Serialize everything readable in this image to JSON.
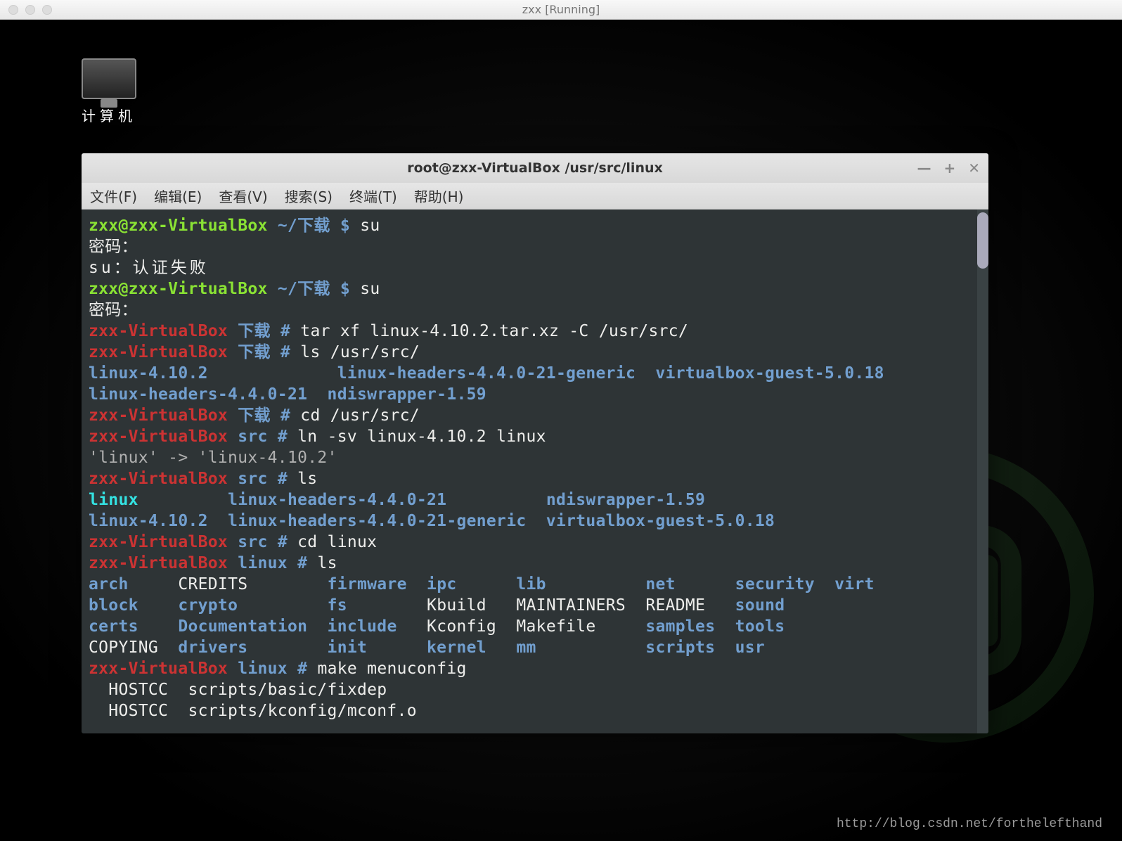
{
  "vm_title": "zxx [Running]",
  "desktop": {
    "computer_label": "计算机"
  },
  "term": {
    "title": "root@zxx-VirtualBox /usr/src/linux",
    "menu": {
      "file": "文件(F)",
      "edit": "编辑(E)",
      "view": "查看(V)",
      "search": "搜索(S)",
      "terminal": "终端(T)",
      "help": "帮助(H)"
    },
    "controls": {
      "min": "—",
      "max": "+",
      "close": "✕"
    },
    "p1": {
      "userhost": "zxx@zxx-VirtualBox",
      "path": "~/下载",
      "sep": "$",
      "cmd": "su"
    },
    "pwd_label": "密码：",
    "su_fail": "su：认证失败",
    "p2": {
      "userhost": "zxx@zxx-VirtualBox",
      "path": "~/下载",
      "sep": "$",
      "cmd": "su"
    },
    "pwd_label2": "密码：",
    "r1": {
      "host": "zxx-VirtualBox",
      "path": "下载",
      "sep": "#",
      "cmd": "tar xf linux-4.10.2.tar.xz -C /usr/src/"
    },
    "r2": {
      "host": "zxx-VirtualBox",
      "path": "下载",
      "sep": "#",
      "cmd": "ls /usr/src/"
    },
    "ls_src1": {
      "a1": "linux-4.10.2",
      "a2": "linux-headers-4.4.0-21-generic",
      "a3": "virtualbox-guest-5.0.18"
    },
    "ls_src2": {
      "a1": "linux-headers-4.4.0-21",
      "a2": "ndiswrapper-1.59"
    },
    "r3": {
      "host": "zxx-VirtualBox",
      "path": "下载",
      "sep": "#",
      "cmd": "cd /usr/src/"
    },
    "r4": {
      "host": "zxx-VirtualBox",
      "path": "src",
      "sep": "#",
      "cmd": "ln -sv linux-4.10.2 linux"
    },
    "ln_out": "'linux' -> 'linux-4.10.2'",
    "r5": {
      "host": "zxx-VirtualBox",
      "path": "src",
      "sep": "#",
      "cmd": "ls"
    },
    "ls_src3": {
      "a1": "linux",
      "a2": "linux-headers-4.4.0-21",
      "a3": "ndiswrapper-1.59"
    },
    "ls_src4": {
      "a1": "linux-4.10.2",
      "a2": "linux-headers-4.4.0-21-generic",
      "a3": "virtualbox-guest-5.0.18"
    },
    "r6": {
      "host": "zxx-VirtualBox",
      "path": "src",
      "sep": "#",
      "cmd": "cd linux"
    },
    "r7": {
      "host": "zxx-VirtualBox",
      "path": "linux",
      "sep": "#",
      "cmd": "ls"
    },
    "ls_linux": {
      "row1": [
        "arch",
        "CREDITS",
        "firmware",
        "ipc",
        "lib",
        "net",
        "security",
        "virt"
      ],
      "row2": [
        "block",
        "crypto",
        "fs",
        "Kbuild",
        "MAINTAINERS",
        "README",
        "sound",
        ""
      ],
      "row3": [
        "certs",
        "Documentation",
        "include",
        "Kconfig",
        "Makefile",
        "samples",
        "tools",
        ""
      ],
      "row4": [
        "COPYING",
        "drivers",
        "init",
        "kernel",
        "mm",
        "scripts",
        "usr",
        ""
      ]
    },
    "r8": {
      "host": "zxx-VirtualBox",
      "path": "linux",
      "sep": "#",
      "cmd": "make menuconfig"
    },
    "mc1": "  HOSTCC  scripts/basic/fixdep",
    "mc2": "  HOSTCC  scripts/kconfig/mconf.o"
  },
  "watermark": "http://blog.csdn.net/forthelefthand"
}
